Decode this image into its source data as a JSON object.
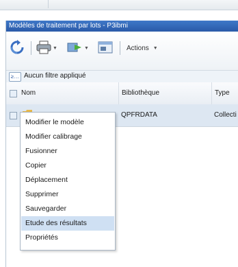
{
  "panel": {
    "title": "Modèles de traitement par lots - P3ibmi"
  },
  "toolbar": {
    "refresh_icon": "refresh-icon",
    "print_icon": "print-icon",
    "export_icon": "export-icon",
    "window_icon": "window-icon",
    "actions_label": "Actions"
  },
  "filter": {
    "icon_label": "≥…",
    "text": "Aucun filtre appliqué"
  },
  "table": {
    "columns": [
      "Nom",
      "Bibliothèque",
      "Type"
    ],
    "rows": [
      {
        "name": "",
        "library": "QPFRDATA",
        "type": "Collecti"
      }
    ]
  },
  "context_menu": {
    "items": [
      "Modifier le modèle",
      "Modifier calibrage",
      "Fusionner",
      "Copier",
      "Déplacement",
      "Supprimer",
      "Sauvegarder",
      "Etude des résultats",
      "Propriétés"
    ],
    "highlighted": "Etude des résultats"
  },
  "colors": {
    "title_bg": "#2f64b4",
    "row_selected": "#dde7f2",
    "menu_highlight": "#cfe0f3"
  }
}
